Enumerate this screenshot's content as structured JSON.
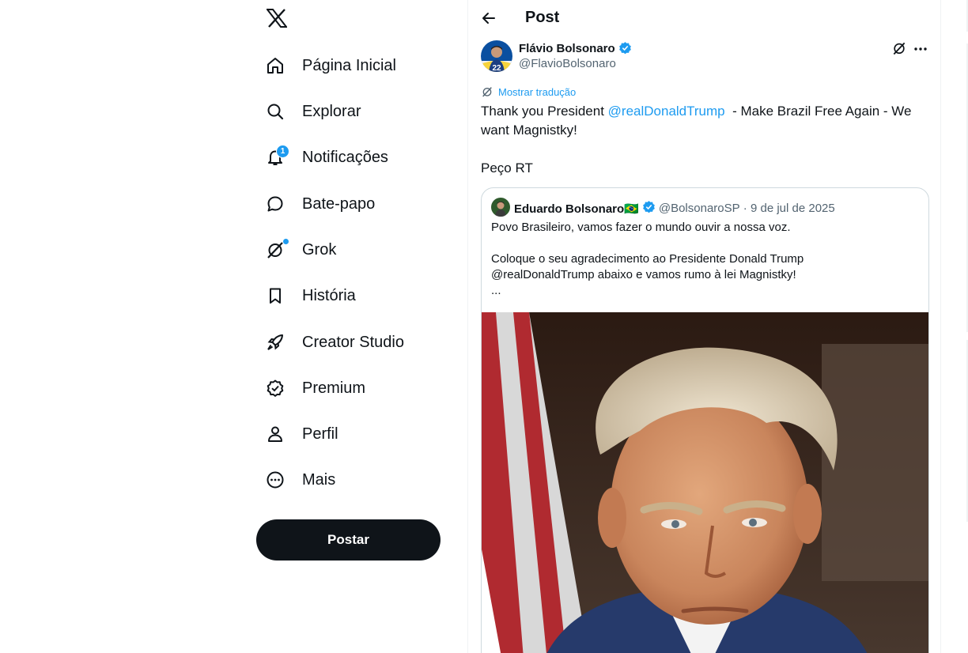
{
  "nav": {
    "items": [
      {
        "label": "Página Inicial",
        "icon": "home-icon"
      },
      {
        "label": "Explorar",
        "icon": "search-icon"
      },
      {
        "label": "Notificações",
        "icon": "bell-icon",
        "badge": "1"
      },
      {
        "label": "Bate-papo",
        "icon": "chat-bubble-icon"
      },
      {
        "label": "Grok",
        "icon": "grok-icon"
      },
      {
        "label": "História",
        "icon": "bookmark-icon"
      },
      {
        "label": "Creator Studio",
        "icon": "rocket-icon"
      },
      {
        "label": "Premium",
        "icon": "verified-badge-icon"
      },
      {
        "label": "Perfil",
        "icon": "person-icon"
      },
      {
        "label": "Mais",
        "icon": "more-circle-icon"
      }
    ],
    "post_button": "Postar"
  },
  "header": {
    "title": "Post"
  },
  "post": {
    "author_name": "Flávio Bolsonaro",
    "author_handle": "@FlavioBolsonaro",
    "translate_label": "Mostrar tradução",
    "text_before": "Thank you President ",
    "mention": "@realDonaldTrump",
    "text_after": "  - Make Brazil Free Again - We want Magnistky!",
    "text_line2": "Peço RT",
    "avatar_number": "22"
  },
  "quote": {
    "author_name": "Eduardo Bolsonaro🇧🇷",
    "author_handle": "@BolsonaroSP",
    "separator": " · ",
    "date": "9 de jul de 2025",
    "line1": "Povo Brasileiro, vamos fazer o mundo ouvir a nossa voz.",
    "line2": "Coloque o seu agradecimento ao Presidente Donald Trump",
    "line3": "@realDonaldTrump abaixo e vamos rumo à lei Magnistky!",
    "line4": "..."
  },
  "colors": {
    "accent": "#1d9bf0",
    "text": "#0f1419",
    "muted": "#536471",
    "border": "#cfd9de"
  }
}
